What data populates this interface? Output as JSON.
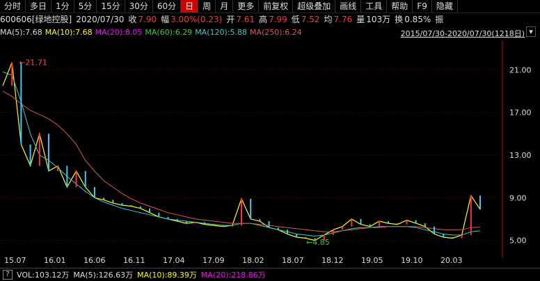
{
  "toolbar": {
    "items": [
      "分时",
      "多日",
      "1分",
      "5分",
      "15分",
      "30分",
      "60分",
      "日",
      "周",
      "月",
      "更多",
      "前复权",
      "超级叠加",
      "画线",
      "工具",
      "帮助",
      "F9",
      "隐藏"
    ],
    "active_index": 7
  },
  "info": {
    "code": "600606[绿地控股]",
    "date": "2020/07/30",
    "close_label": "收",
    "close": "7.90",
    "amp_label": "幅",
    "amp": "3.00%(0.23)",
    "open_label": "开",
    "open": "7.61",
    "high_label": "高",
    "high": "7.99",
    "low_label": "低",
    "low": "7.52",
    "avg_label": "均",
    "avg": "7.76",
    "vol_label": "量",
    "vol": "103万",
    "turn_label": "换",
    "turn": "0.85%",
    "zhen_label": "振"
  },
  "ma": {
    "ma5": "MA(5):7.68",
    "ma10": "MA(10):7.68",
    "ma20": "MA(20):8.05",
    "ma60": "MA(60):6.29",
    "ma120": "MA(120):5.88",
    "ma250": "MA(250):6.24"
  },
  "period": "2015/07/30-2020/07/30(1218日)",
  "drop_icon": "▾",
  "chart_data": {
    "type": "line",
    "title": "",
    "ylim": [
      3.8,
      23.5
    ],
    "yticks": [
      "21.00",
      "17.00",
      "13.00",
      "9.00",
      "5.00"
    ],
    "ytick_values": [
      21,
      17,
      13,
      9,
      5
    ],
    "xticks": [
      "15.07",
      "16.01",
      "16.06",
      "16.11",
      "17.04",
      "17.09",
      "18.02",
      "18.07",
      "18.12",
      "19.05",
      "19.10",
      "20.03"
    ],
    "annotations": {
      "max": "21.71",
      "min": "4.85"
    },
    "series": [
      {
        "name": "price",
        "color": "#ffff00",
        "values": [
          19.5,
          21.7,
          14,
          12,
          15,
          11.5,
          12,
          10,
          11.5,
          10,
          9,
          8.8,
          8.5,
          8.3,
          8.2,
          8.0,
          7.6,
          7.2,
          7.0,
          6.8,
          6.6,
          6.7,
          6.5,
          6.4,
          6.3,
          6.4,
          8.9,
          7.0,
          6.8,
          6.2,
          6.0,
          5.6,
          5.3,
          5.2,
          5.0,
          5.5,
          6.0,
          6.3,
          7.0,
          6.5,
          6.3,
          6.8,
          6.6,
          6.5,
          6.9,
          6.6,
          6.3,
          5.6,
          5.3,
          5.2,
          5.5,
          9.2,
          7.9
        ]
      },
      {
        "name": "MA(120)",
        "color": "#33cccc",
        "values": [
          20.8,
          20.5,
          18,
          15,
          13,
          12.5,
          11.8,
          11,
          10.3,
          9.6,
          9,
          8.6,
          8.3,
          8.0,
          7.8,
          7.6,
          7.4,
          7.2,
          7.0,
          6.9,
          6.8,
          6.7,
          6.6,
          6.5,
          6.4,
          6.4,
          6.6,
          6.6,
          6.4,
          6.2,
          6.0,
          5.8,
          5.6,
          5.5,
          5.4,
          5.5,
          5.7,
          5.9,
          6.1,
          6.2,
          6.2,
          6.3,
          6.3,
          6.3,
          6.3,
          6.2,
          6.0,
          5.8,
          5.6,
          5.5,
          5.5,
          5.8,
          5.9
        ]
      },
      {
        "name": "MA(250)",
        "color": "#dd5555",
        "values": [
          19,
          18.5,
          17.8,
          17.2,
          16.8,
          16.4,
          15.8,
          15.0,
          14.0,
          12.5,
          11.5,
          10.6,
          10.0,
          9.4,
          8.9,
          8.5,
          8.2,
          7.9,
          7.6,
          7.4,
          7.2,
          7.0,
          6.9,
          6.8,
          6.7,
          6.6,
          6.6,
          6.6,
          6.5,
          6.4,
          6.3,
          6.2,
          6.1,
          6.0,
          5.9,
          5.8,
          5.8,
          5.9,
          6.0,
          6.1,
          6.2,
          6.2,
          6.3,
          6.3,
          6.3,
          6.3,
          6.2,
          6.1,
          6.0,
          6.0,
          6.0,
          6.2,
          6.24
        ]
      }
    ]
  },
  "vol": {
    "q": "?",
    "vol": "VOL:103.12万",
    "ma5": "MA(5):126.63万",
    "ma10": "MA(10):89.39万",
    "ma20": "MA(20):218.86万"
  }
}
